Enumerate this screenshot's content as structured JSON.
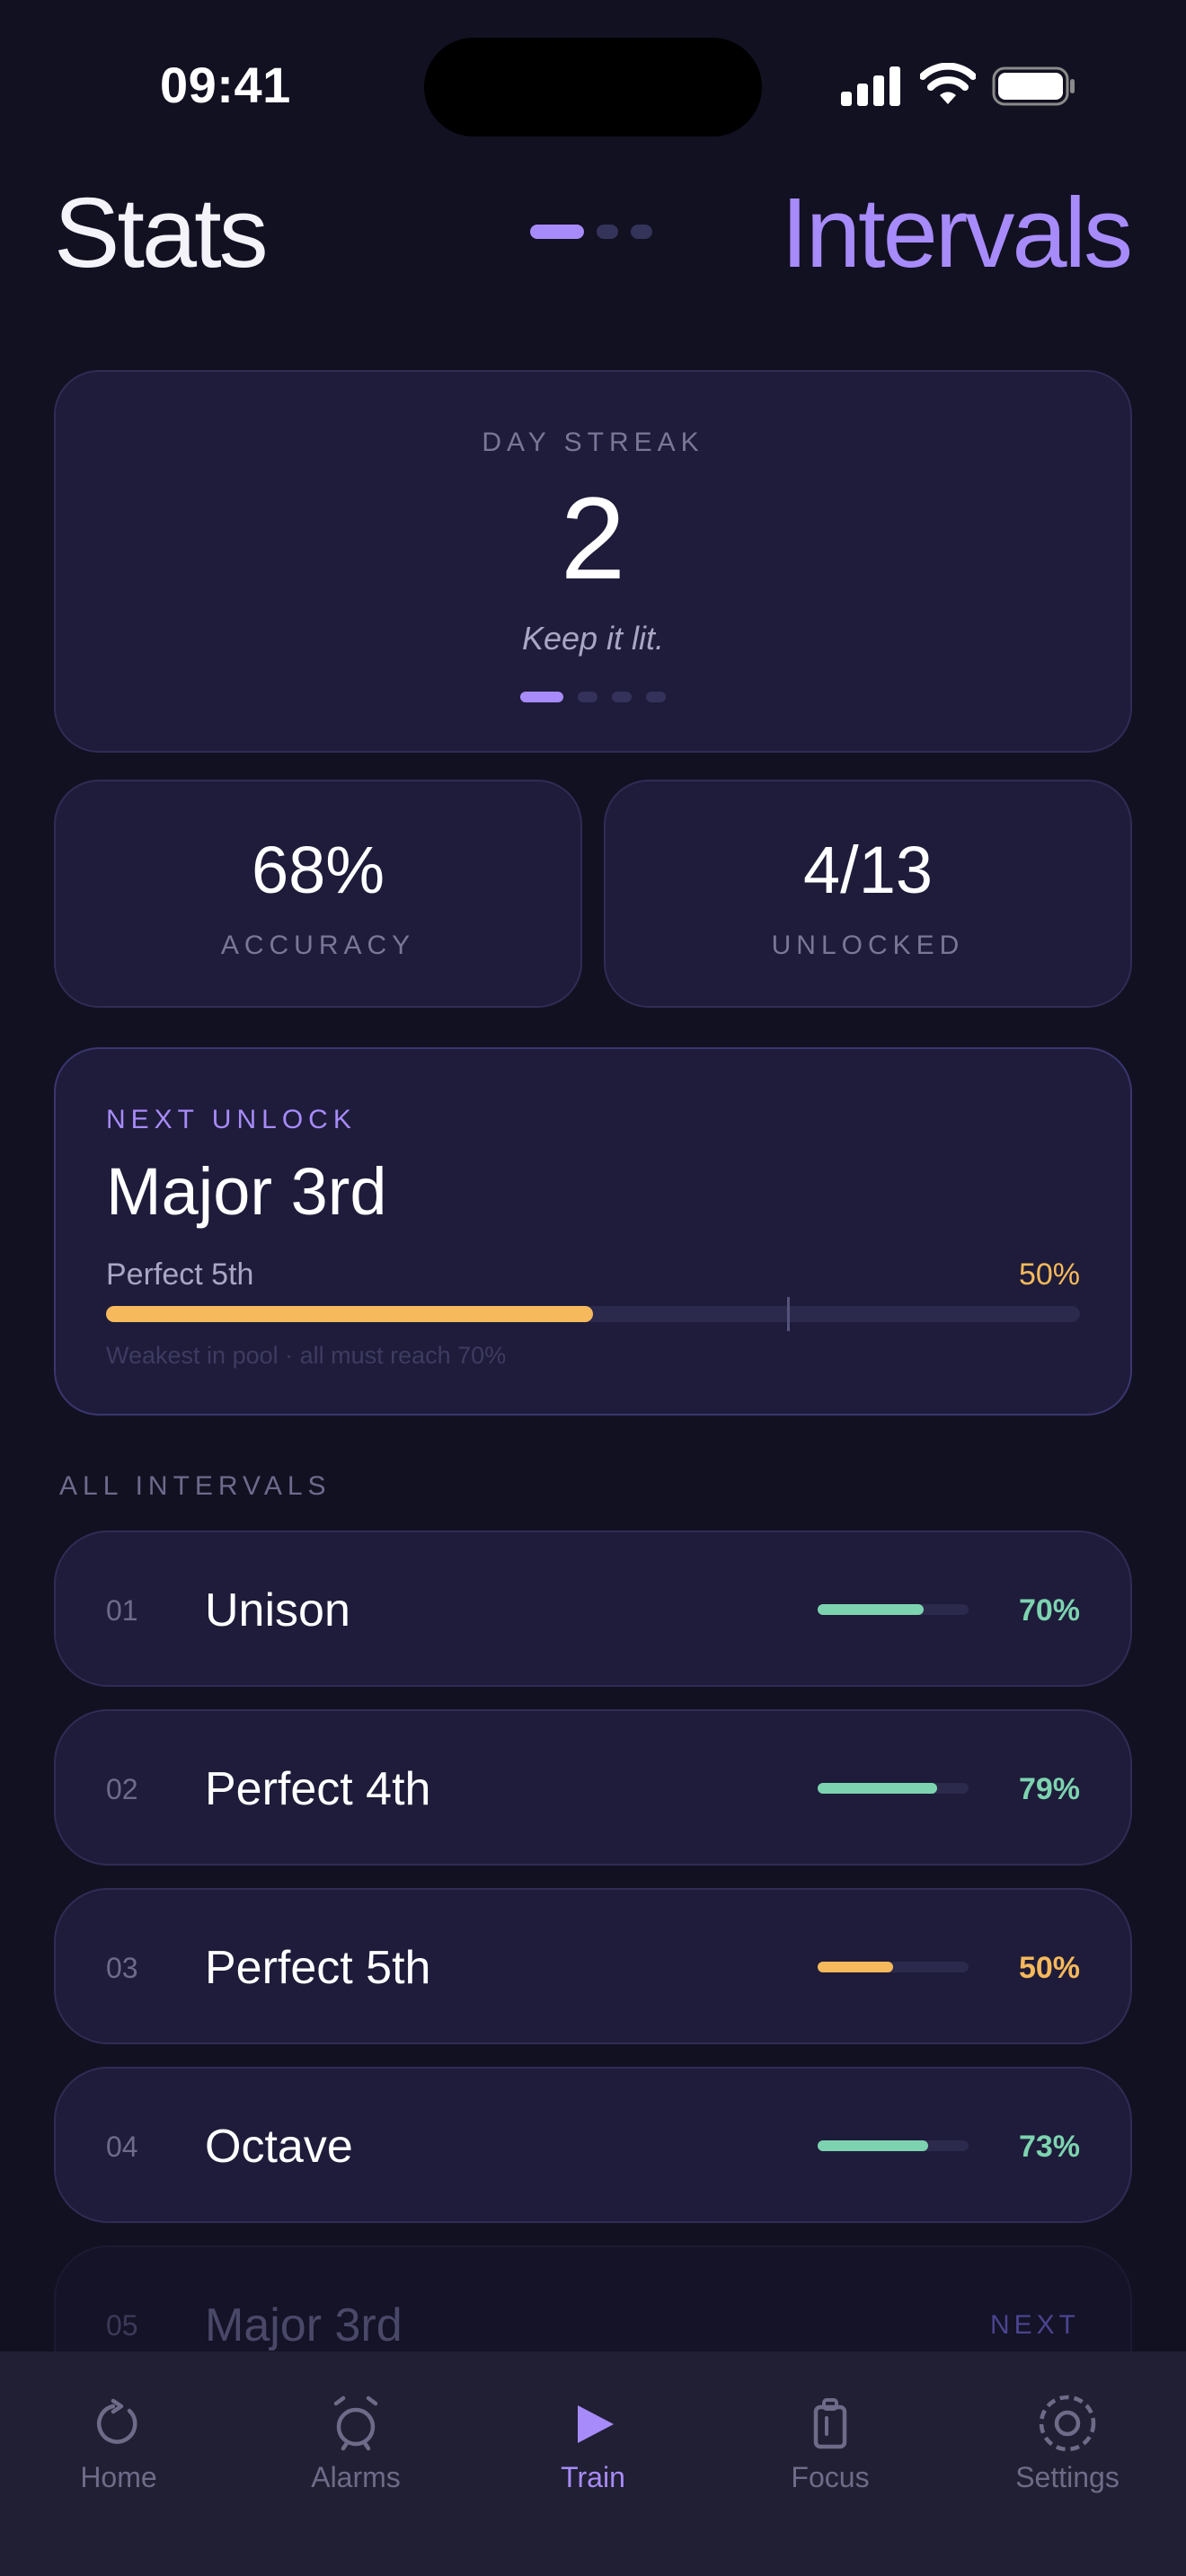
{
  "status_bar": {
    "time": "09:41"
  },
  "header": {
    "title": "Stats",
    "accent_title": "Intervals",
    "page_dots": 3,
    "active_page": 0
  },
  "streak": {
    "label": "DAY STREAK",
    "value": "2",
    "subtitle": "Keep it lit.",
    "dots": 4,
    "active_dot": 0
  },
  "stats": [
    {
      "value": "68%",
      "label": "ACCURACY"
    },
    {
      "value": "4/13",
      "label": "UNLOCKED"
    }
  ],
  "next_unlock": {
    "label": "NEXT UNLOCK",
    "name": "Major 3rd",
    "weakest_interval": "Perfect 5th",
    "weakest_percent": "50%",
    "progress": 0.5,
    "threshold": 0.7,
    "note": "Weakest in pool · all must reach 70%"
  },
  "section": {
    "label": "ALL INTERVALS"
  },
  "intervals": [
    {
      "num": "01",
      "name": "Unison",
      "percent": "70%",
      "progress": 0.7,
      "status": "good"
    },
    {
      "num": "02",
      "name": "Perfect 4th",
      "percent": "79%",
      "progress": 0.79,
      "status": "good"
    },
    {
      "num": "03",
      "name": "Perfect 5th",
      "percent": "50%",
      "progress": 0.5,
      "status": "weak"
    },
    {
      "num": "04",
      "name": "Octave",
      "percent": "73%",
      "progress": 0.73,
      "status": "good"
    }
  ],
  "locked_next": {
    "num": "05",
    "name": "Major 3rd",
    "tag": "NEXT"
  },
  "tabs": [
    {
      "label": "Home",
      "icon": "home-icon"
    },
    {
      "label": "Alarms",
      "icon": "alarm-icon"
    },
    {
      "label": "Train",
      "icon": "play-icon",
      "active": true
    },
    {
      "label": "Focus",
      "icon": "focus-icon"
    },
    {
      "label": "Settings",
      "icon": "settings-icon"
    }
  ],
  "colors": {
    "background": "#121122",
    "card": "#1e1c3a",
    "accent": "#a78bfa",
    "good": "#7dd3b0",
    "weak": "#f6b95b",
    "muted": "#6e6a8c"
  }
}
